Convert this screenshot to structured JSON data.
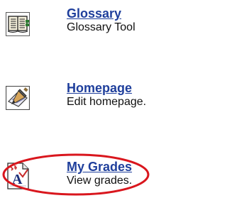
{
  "tools": [
    {
      "id": "glossary",
      "icon": "book-icon",
      "title": "Glossary",
      "description": "Glossary Tool"
    },
    {
      "id": "homepage",
      "icon": "pencil-edit-icon",
      "title": "Homepage",
      "description": "Edit homepage."
    },
    {
      "id": "my-grades",
      "icon": "grade-report-icon",
      "title": "My Grades",
      "description": "View grades.",
      "highlighted": true
    }
  ],
  "colors": {
    "link": "#1f3f9c",
    "description": "#111111",
    "highlight_ellipse": "#d9161d"
  }
}
